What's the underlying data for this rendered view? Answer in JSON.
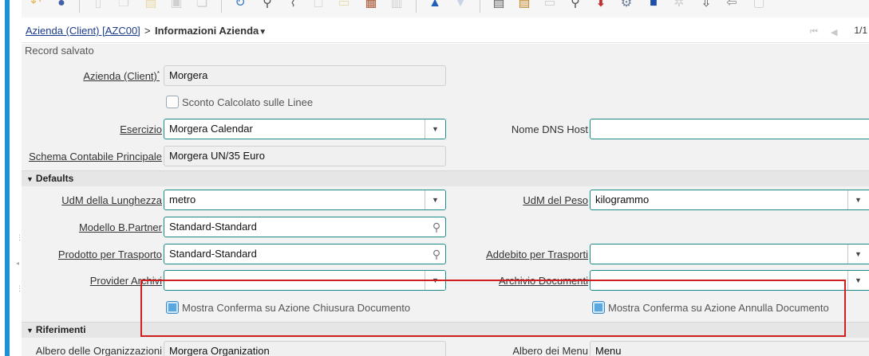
{
  "window": {
    "breadcrumb_link": "Azienda (Client) [AZC00]",
    "breadcrumb_sep": ">",
    "breadcrumb_current": "Informazioni Azienda",
    "record_count": "1/1",
    "status_message": "Record salvato"
  },
  "colors": {
    "accent_rail": "#1e90d8",
    "highlight_border": "#d11f1f",
    "link": "#1a3a8c"
  },
  "toolbar": {
    "icons": [
      "undo-icon",
      "help-icon",
      "new-record-icon",
      "copy-record-icon",
      "delete-icon",
      "save-icon",
      "save-new-icon",
      "refresh-icon",
      "find-icon",
      "attachment-icon",
      "chat-icon",
      "history-icon",
      "grid-toggle-icon",
      "detail-icon",
      "previous-record-icon",
      "next-record-icon",
      "report-icon",
      "archive-icon",
      "print-icon",
      "print-preview-icon",
      "zoom-across-icon",
      "process-icon",
      "workflow-icon",
      "customize-icon",
      "export-icon",
      "import-icon",
      "lock-icon"
    ]
  },
  "fields": {
    "azienda_label": "Azienda (Client)",
    "azienda_value": "Morgera",
    "sconto_label": "Sconto Calcolato sulle Linee",
    "esercizio_label": "Esercizio",
    "esercizio_value": "Morgera Calendar",
    "nome_dns_label": "Nome DNS Host",
    "nome_dns_value": "",
    "schema_label": "Schema Contabile Principale",
    "schema_value": "Morgera UN/35 Euro"
  },
  "defaults": {
    "section_label": "Defaults",
    "udm_lunghezza_label": "UdM della Lunghezza",
    "udm_lunghezza_value": "metro",
    "udm_peso_label": "UdM del Peso",
    "udm_peso_value": "kilogrammo",
    "modello_bp_label": "Modello B.Partner",
    "modello_bp_value": "Standard-Standard",
    "prodotto_trasporto_label": "Prodotto per Trasporto",
    "prodotto_trasporto_value": "Standard-Standard",
    "addebito_trasporti_label": "Addebito per Trasporti",
    "addebito_trasporti_value": "",
    "provider_archivi_label": "Provider Archivi",
    "provider_archivi_value": "",
    "archivio_documenti_label": "Archivio Documenti",
    "archivio_documenti_value": "",
    "conferma_chiusura_label": "Mostra Conferma su Azione Chiusura Documento",
    "conferma_annulla_label": "Mostra Conferma su Azione Annulla Documento"
  },
  "riferimenti": {
    "section_label": "Riferimenti",
    "albero_org_label": "Albero delle Organizzazioni",
    "albero_org_value": "Morgera Organization",
    "albero_menu_label": "Albero dei Menu",
    "albero_menu_value": "Menu"
  }
}
